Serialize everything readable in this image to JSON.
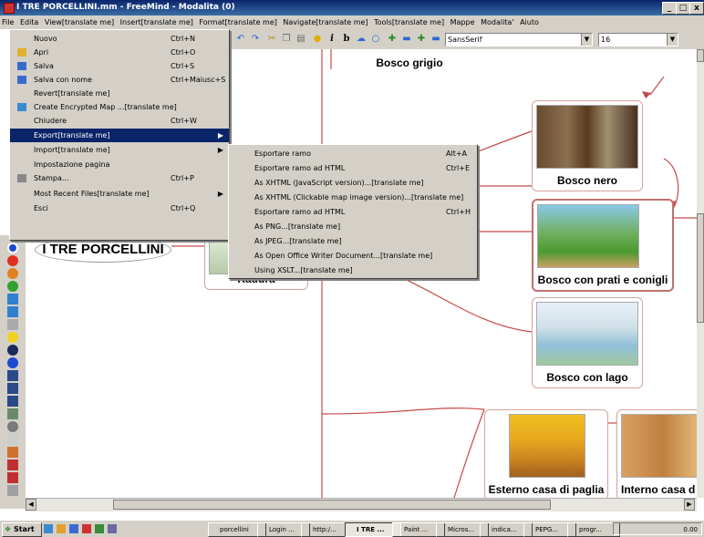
{
  "window": {
    "title": "I TRE PORCELLINI.mm - FreeMind - Modalita (0)",
    "minimize": "_",
    "restore": "□",
    "close": "x"
  },
  "menubar": [
    "File",
    "Edita",
    "View[translate me]",
    "Insert[translate me]",
    "Format[translate me]",
    "Navigate[translate me]",
    "Tools[translate me]",
    "Mappe",
    "Modalita'",
    "Aiuto"
  ],
  "toolbar": {
    "font": "SansSerif",
    "size": "16"
  },
  "file_menu": [
    {
      "label": "Nuovo",
      "shortcut": "Ctrl+N"
    },
    {
      "label": "Apri",
      "shortcut": "Ctrl+O"
    },
    {
      "label": "Salva",
      "shortcut": "Ctrl+S"
    },
    {
      "label": "Salva con nome",
      "shortcut": "Ctrl+Maiusc+S"
    },
    {
      "label": "Revert[translate me]",
      "shortcut": ""
    },
    {
      "label": "Create Encrypted Map ...[translate me]",
      "shortcut": ""
    },
    {
      "label": "Chiudere",
      "shortcut": "Ctrl+W"
    },
    {
      "label": "Export[translate me]",
      "shortcut": ""
    },
    {
      "label": "Import[translate me]",
      "shortcut": ""
    },
    {
      "label": "Impostazione pagina",
      "shortcut": ""
    },
    {
      "label": "Stampa...",
      "shortcut": "Ctrl+P"
    },
    {
      "label": "Most Recent Files[translate me]",
      "shortcut": ""
    },
    {
      "label": "Esci",
      "shortcut": "Ctrl+Q"
    }
  ],
  "export_submenu": [
    {
      "label": "Esportare ramo",
      "shortcut": "Alt+A"
    },
    {
      "label": "Esportare ramo ad HTML",
      "shortcut": "Ctrl+E"
    },
    {
      "label": "As XHTML (JavaScript version)...[translate me]",
      "shortcut": ""
    },
    {
      "label": "As XHTML (Clickable map image version)...[translate me]",
      "shortcut": ""
    },
    {
      "label": "Esportare ramo ad HTML",
      "shortcut": "Ctrl+H"
    },
    {
      "label": "As PNG...[translate me]",
      "shortcut": ""
    },
    {
      "label": "As JPEG...[translate me]",
      "shortcut": ""
    },
    {
      "label": "As Open Office Writer Document...[translate me]",
      "shortcut": ""
    },
    {
      "label": "Using XSLT...[translate me]",
      "shortcut": ""
    }
  ],
  "nodes": {
    "root": "I TRE PORCELLINI",
    "radura": "Radura",
    "bosco_grigio": "Bosco grigio",
    "bosco_nero": "Bosco nero",
    "bosco_prati": "Bosco con prati e conigli",
    "bosco_lago": "Bosco con lago",
    "esterno_paglia": "Esterno casa di paglia",
    "interno_casa": "Interno casa d"
  },
  "taskbar": {
    "start": "Start",
    "tasks": [
      "porcellini",
      "Login ...",
      "http:/...",
      "I TRE ...",
      "Paint ...",
      "Micros...",
      "indica...",
      "PEPG...",
      "progr..."
    ],
    "clock": "0.00"
  },
  "colors": {
    "accent": "#0a246a",
    "edge": "#c84a4a",
    "node_border": "#d8a0a0",
    "chrome": "#d4d0c8"
  }
}
